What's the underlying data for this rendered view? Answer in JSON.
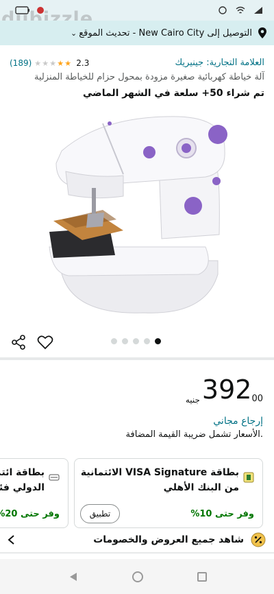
{
  "delivery": {
    "text": "التوصيل إلى New Cairo City - تحديث الموقع"
  },
  "product": {
    "brand": "العلامة التجارية: جينيريك",
    "title": "آلة خياطة كهربائية صغيرة مزودة بمحول حزام للخياطة المنزلية",
    "rating_value": "2.3",
    "rating_stars": 2.3,
    "rating_count": "(189)",
    "sold_text": "تم شراء 50+ سلعة في الشهر الماضي",
    "image_count": 5,
    "active_image": 5
  },
  "price": {
    "main": "392",
    "fraction": "00",
    "currency": "جنيه",
    "returns": "إرجاع مجاني",
    "vat": ".الأسعار تشمل ضريبة القيمة المضافة"
  },
  "offers": [
    {
      "title_line1": "بطاقة VISA Signature الائتمانية",
      "title_line2": "من البنك الأهلي",
      "save": "وفر حتى 10%",
      "button": "تطبيق"
    },
    {
      "title_line1": "بطاقة ائتمانية",
      "title_line2": "الدولي فئة",
      "save": "وفر حتى 20%"
    }
  ],
  "all_offers_label": "شاهد جميع العروض والخصومات",
  "colors": {
    "link": "#007185",
    "save": "#007600",
    "star": "#ffa41c",
    "delivery_bg": "#d7eef0"
  }
}
